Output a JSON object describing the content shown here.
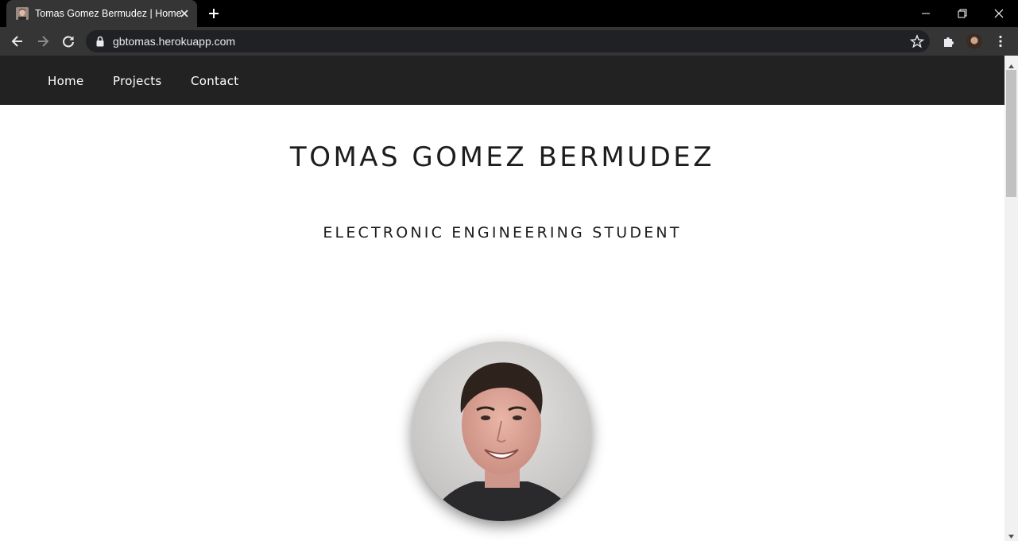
{
  "browser": {
    "tab_title": "Tomas Gomez Bermudez | Home",
    "url": "gbtomas.herokuapp.com"
  },
  "nav": {
    "items": [
      {
        "label": "Home"
      },
      {
        "label": "Projects"
      },
      {
        "label": "Contact"
      }
    ]
  },
  "hero": {
    "title": "TOMAS GOMEZ BERMUDEZ",
    "subtitle": "ELECTRONIC ENGINEERING STUDENT"
  },
  "colors": {
    "nav_background": "#222222",
    "page_background": "#ffffff",
    "text_dark": "#1d1d1d"
  },
  "icons": {
    "tab": [
      "favicon",
      "close-icon",
      "new-tab-icon"
    ],
    "window": [
      "minimize-icon",
      "restore-icon",
      "close-window-icon"
    ],
    "toolbar": [
      "back-arrow-icon",
      "forward-arrow-icon",
      "reload-icon",
      "lock-icon",
      "star-icon",
      "extensions-icon",
      "profile-avatar",
      "kebab-menu-icon"
    ]
  }
}
